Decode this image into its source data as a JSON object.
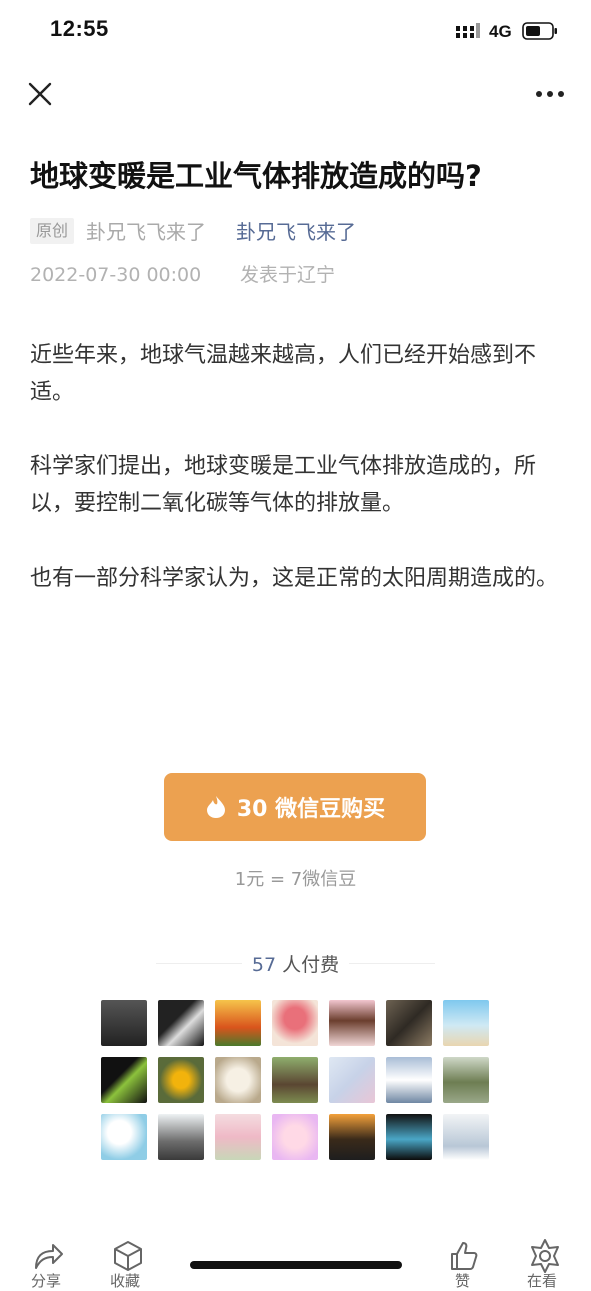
{
  "status_bar": {
    "time": "12:55",
    "network": "4G"
  },
  "article": {
    "title": "地球变暖是工业气体排放造成的吗?",
    "original_badge": "原创",
    "author_plain": "卦兄飞飞来了",
    "author_link": "卦兄飞飞来了",
    "date": "2022-07-30 00:00",
    "location": "发表于辽宁",
    "paragraphs": [
      "近些年来，地球气温越来越高，人们已经开始感到不适。",
      "科学家们提出，地球变暖是工业气体排放造成的，所以，要控制二氧化碳等气体的排放量。",
      "也有一部分科学家认为，这是正常的太阳周期造成的。"
    ]
  },
  "purchase": {
    "button_label": "30 微信豆购买",
    "rate": "1元 = 7微信豆",
    "payers_count": "57",
    "payers_suffix": " 人付费"
  },
  "bottom_bar": {
    "share_label": "分享",
    "favorite_label": "收藏",
    "like_label": "赞",
    "wow_label": "在看"
  },
  "colors": {
    "accent_orange": "#eca150",
    "link_blue": "#576b95"
  }
}
